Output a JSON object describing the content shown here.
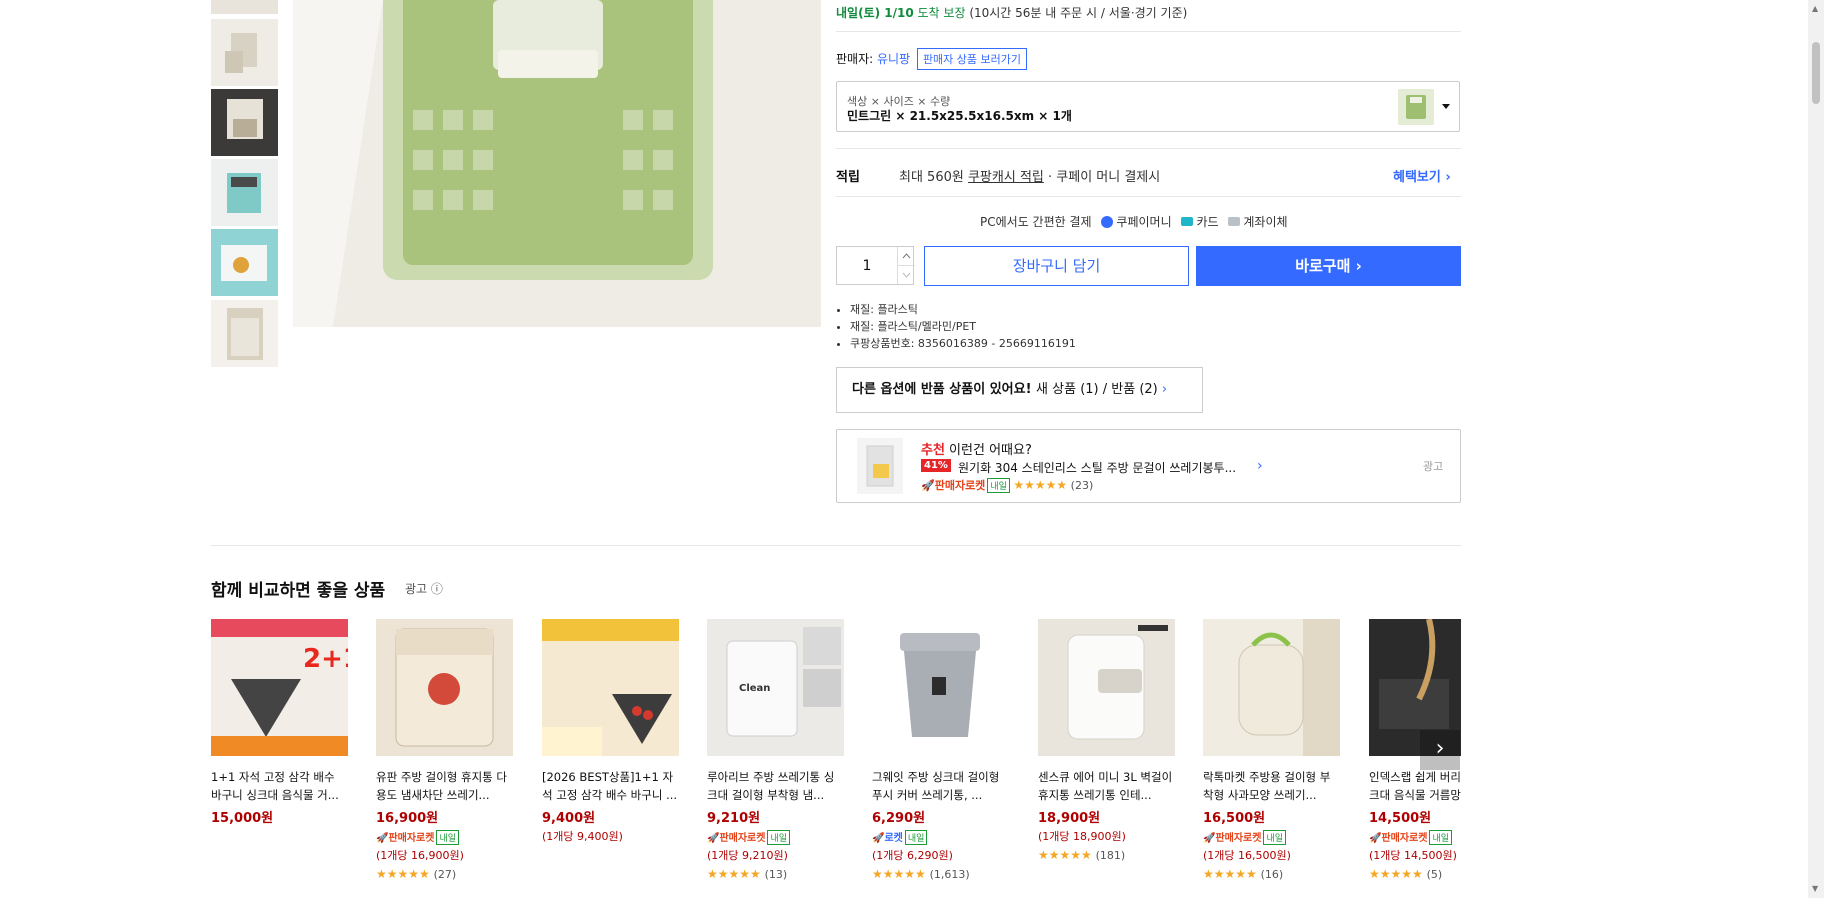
{
  "delivery": {
    "date": "내일(토) 1/10",
    "guarantee": " 도착 보장",
    "detail": " (10시간 56분 내 주문 시 / 서울·경기 기준)"
  },
  "seller": {
    "label": "판매자: ",
    "name": "유니팡",
    "view_button": "판매자 상품 보러가기"
  },
  "option": {
    "label": "색상 × 사이즈 × 수량",
    "value": "민트그린 × 21.5x25.5x16.5xm × 1개"
  },
  "reward": {
    "label": "적립",
    "prefix": "최대 560원 ",
    "link": "쿠팡캐시 적립",
    "suffix": " · 쿠페이 머니 결제시",
    "benefit": "혜택보기 ›"
  },
  "payment": {
    "intro": "PC에서도 간편한 결제",
    "methods": [
      "쿠페이머니",
      "카드",
      "계좌이체"
    ]
  },
  "purchase": {
    "quantity": "1",
    "cart_label": "장바구니 담기",
    "buy_label": "바로구매 ›"
  },
  "specs": [
    "재질: 플라스틱",
    "재질: 플라스틱/멜라민/PET",
    "쿠팡상품번호: 8356016389 - 25669116191"
  ],
  "returns": {
    "bold": "다른 옵션에 반품 상품이 있어요! ",
    "new": "새 상품 (1)",
    "sep": " / ",
    "ret": "반품 (2)",
    "chev": "›"
  },
  "recommend": {
    "title_red": "추천",
    "title": " 이런건 어때요?",
    "discount": "41%",
    "name": "원기화 304 스테인리스 스틸 주방 문걸이 쓰레기봉투...",
    "badge": "판매자로켓",
    "badge_day": "내일",
    "stars": "★★★★★",
    "count": "(23)",
    "ad": "광고"
  },
  "compare": {
    "title": "함께 비교하면 좋을 상품",
    "ad": "광고 ⓘ",
    "products": [
      {
        "name": "1+1 자석 고정 삼각 배수 바구니 싱크대 음식물 거...",
        "price": "15,000원",
        "badge": "",
        "badge_day": "",
        "unit": "",
        "stars": "",
        "count": ""
      },
      {
        "name": "유판 주방 걸이형 휴지통 다용도 냄새차단 쓰레기...",
        "price": "16,900원",
        "badge": "판매자로켓",
        "badge_day": "내일",
        "unit": "(1개당 16,900원)",
        "stars": "★★★★★",
        "count": "(27)"
      },
      {
        "name": "[2026 BEST상품]1+1 자석 고정 삼각 배수 바구니 ...",
        "price": "9,400원",
        "badge": "",
        "badge_day": "",
        "unit": "(1개당 9,400원)",
        "stars": "",
        "count": ""
      },
      {
        "name": "루아리브 주방 쓰레기통 싱크대 걸이형 부착형 냄...",
        "price": "9,210원",
        "badge": "판매자로켓",
        "badge_day": "내일",
        "unit": "(1개당 9,210원)",
        "stars": "★★★★★",
        "count": "(13)"
      },
      {
        "name": "그웨잇 주방 싱크대 걸이형 푸시 커버 쓰레기통, ...",
        "price": "6,290원",
        "badge": "로켓",
        "badge_day": "내일",
        "unit": "(1개당 6,290원)",
        "stars": "★★★★★",
        "count": "(1,613)"
      },
      {
        "name": "센스큐 에어 미니 3L 벽걸이 휴지통 쓰레기통 인테...",
        "price": "18,900원",
        "badge": "",
        "badge_day": "",
        "unit": "(1개당 18,900원)",
        "stars": "★★★★★",
        "count": "(181)"
      },
      {
        "name": "락톡마켓 주방용 걸이형 부착형 사과모양 쓰레기...",
        "price": "16,500원",
        "badge": "판매자로켓",
        "badge_day": "내일",
        "unit": "(1개당 16,500원)",
        "stars": "★★★★★",
        "count": "(16)"
      },
      {
        "name": "인덱스랩 쉽게 버리 크대 음식물 거름망",
        "price": "14,500원",
        "badge": "판매자로켓",
        "badge_day": "내일",
        "unit": "(1개당 14,500원)",
        "stars": "★★★★★",
        "count": "(5)"
      }
    ]
  },
  "colors": {
    "accent": "#346aff",
    "price": "#ae0000",
    "delivery": "#118c3d",
    "star": "#f5a623"
  }
}
